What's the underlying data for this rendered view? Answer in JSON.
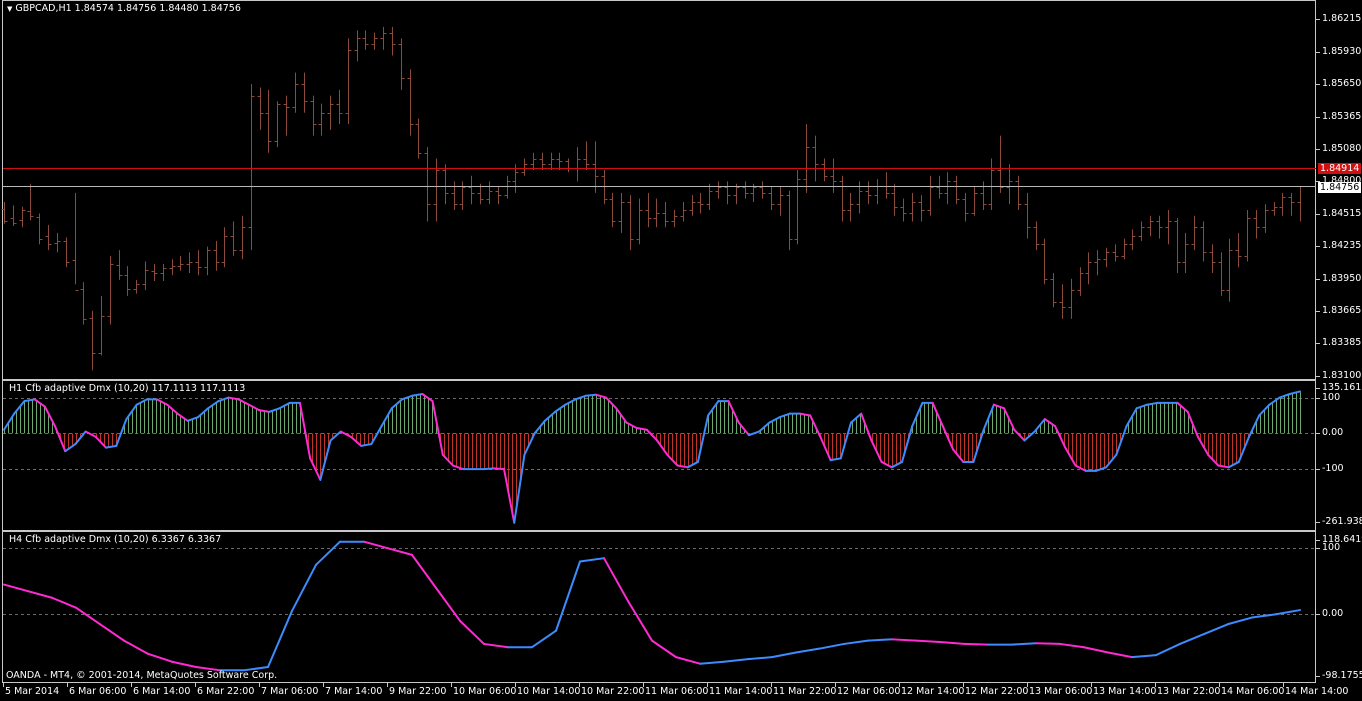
{
  "chart_title": "GBPCAD,H1  1.84574 1.84756 1.84480 1.84756",
  "copyright": "OANDA - MT4, © 2001-2014, MetaQuotes Software Corp.",
  "colors": {
    "candle": "#8b4a3a",
    "bid_line": "#b8b8b8",
    "level_line": "#d01010",
    "bull": "#3c8cff",
    "bear": "#ff2ad4",
    "hist_up": "#6ea86e",
    "hist_down": "#c0352a",
    "background": "#000000",
    "frame": "#c8c8c8"
  },
  "price_pane": {
    "price_labels": [
      "1.86215",
      "1.85930",
      "1.85650",
      "1.85365",
      "1.85080",
      "1.84800",
      "1.84515",
      "1.84235",
      "1.83950",
      "1.83665",
      "1.83385",
      "1.83100"
    ],
    "level_label": "1.84914",
    "current_label": "1.84756"
  },
  "h1_pane": {
    "title": "H1 Cfb adaptive Dmx (10,20) 117.1113 117.1113",
    "labels": [
      "135.1613",
      "100",
      "0.00",
      "-100",
      "-261.9386"
    ]
  },
  "h4_pane": {
    "title": "H4 Cfb adaptive Dmx (10,20) 6.3367 6.3367",
    "labels": [
      "118.6419",
      "100",
      "0.00",
      "-98.1755"
    ]
  },
  "time_labels": [
    "5 Mar 2014",
    "6 Mar 06:00",
    "6 Mar 14:00",
    "6 Mar 22:00",
    "7 Mar 06:00",
    "7 Mar 14:00",
    "9 Mar 22:00",
    "10 Mar 06:00",
    "10 Mar 14:00",
    "10 Mar 22:00",
    "11 Mar 06:00",
    "11 Mar 14:00",
    "11 Mar 22:00",
    "12 Mar 06:00",
    "12 Mar 14:00",
    "12 Mar 22:00",
    "13 Mar 06:00",
    "13 Mar 14:00",
    "13 Mar 22:00",
    "14 Mar 06:00",
    "14 Mar 14:00"
  ],
  "chart_data": [
    {
      "type": "bar",
      "title": "GBPCAD,H1",
      "ylim": [
        1.831,
        1.8635
      ],
      "hlines": [
        1.84914,
        1.84756
      ],
      "bars": [
        [
          1.8456,
          1.8443,
          1.8462,
          1.8445
        ],
        [
          1.8448,
          1.8441,
          1.8459,
          1.8444
        ],
        [
          1.8446,
          1.844,
          1.8458,
          1.8455
        ],
        [
          1.8454,
          1.8446,
          1.8478,
          1.845
        ],
        [
          1.8449,
          1.8425,
          1.8452,
          1.843
        ],
        [
          1.8432,
          1.842,
          1.8442,
          1.8425
        ],
        [
          1.8426,
          1.8418,
          1.8435,
          1.8428
        ],
        [
          1.8428,
          1.8405,
          1.8431,
          1.841
        ],
        [
          1.8411,
          1.839,
          1.847,
          1.8385
        ],
        [
          1.8386,
          1.8355,
          1.8392,
          1.836
        ],
        [
          1.8361,
          1.8315,
          1.8367,
          1.833
        ],
        [
          1.833,
          1.8328,
          1.838,
          1.8362
        ],
        [
          1.8362,
          1.8355,
          1.8415,
          1.8408
        ],
        [
          1.8407,
          1.8394,
          1.842,
          1.8398
        ],
        [
          1.8398,
          1.838,
          1.8406,
          1.8386
        ],
        [
          1.8386,
          1.8382,
          1.8394,
          1.839
        ],
        [
          1.839,
          1.8385,
          1.841,
          1.8403
        ],
        [
          1.8402,
          1.8393,
          1.8408,
          1.84
        ],
        [
          1.84,
          1.8393,
          1.8408,
          1.8404
        ],
        [
          1.8404,
          1.8398,
          1.8412,
          1.8406
        ],
        [
          1.8406,
          1.8402,
          1.8415,
          1.8408
        ],
        [
          1.8408,
          1.84,
          1.8418,
          1.841
        ],
        [
          1.841,
          1.8398,
          1.842,
          1.8405
        ],
        [
          1.8405,
          1.8398,
          1.8423,
          1.842
        ],
        [
          1.842,
          1.8402,
          1.8428,
          1.841
        ],
        [
          1.841,
          1.8405,
          1.844,
          1.8432
        ],
        [
          1.8432,
          1.8415,
          1.8445,
          1.842
        ],
        [
          1.842,
          1.8412,
          1.845,
          1.844
        ],
        [
          1.844,
          1.842,
          1.8565,
          1.8555
        ],
        [
          1.8555,
          1.8525,
          1.8562,
          1.854
        ],
        [
          1.854,
          1.8505,
          1.856,
          1.8515
        ],
        [
          1.8515,
          1.851,
          1.855,
          1.8548
        ],
        [
          1.8548,
          1.852,
          1.8555,
          1.8545
        ],
        [
          1.8545,
          1.854,
          1.8575,
          1.8565
        ],
        [
          1.8565,
          1.854,
          1.8575,
          1.855
        ],
        [
          1.855,
          1.852,
          1.8555,
          1.853
        ],
        [
          1.853,
          1.852,
          1.8548,
          1.854
        ],
        [
          1.854,
          1.8525,
          1.8555,
          1.8548
        ],
        [
          1.8548,
          1.853,
          1.856,
          1.854
        ],
        [
          1.854,
          1.853,
          1.8605,
          1.8595
        ],
        [
          1.8595,
          1.8585,
          1.8612,
          1.8605
        ],
        [
          1.8605,
          1.8595,
          1.8612,
          1.86
        ],
        [
          1.86,
          1.8595,
          1.861,
          1.8605
        ],
        [
          1.8605,
          1.8595,
          1.8615,
          1.861
        ],
        [
          1.861,
          1.859,
          1.8615,
          1.86
        ],
        [
          1.86,
          1.856,
          1.8605,
          1.857
        ],
        [
          1.857,
          1.852,
          1.8578,
          1.853
        ],
        [
          1.853,
          1.85,
          1.8535,
          1.8505
        ],
        [
          1.8505,
          1.8445,
          1.851,
          1.846
        ],
        [
          1.846,
          1.8445,
          1.85,
          1.849
        ],
        [
          1.849,
          1.846,
          1.8495,
          1.847
        ],
        [
          1.847,
          1.8455,
          1.848,
          1.846
        ],
        [
          1.846,
          1.8455,
          1.848,
          1.8475
        ],
        [
          1.8475,
          1.846,
          1.8485,
          1.847
        ],
        [
          1.847,
          1.846,
          1.8478,
          1.8465
        ],
        [
          1.8465,
          1.846,
          1.848,
          1.8472
        ],
        [
          1.8472,
          1.846,
          1.8476,
          1.8468
        ],
        [
          1.8468,
          1.8465,
          1.8485,
          1.848
        ],
        [
          1.848,
          1.847,
          1.8495,
          1.8488
        ],
        [
          1.8488,
          1.8485,
          1.85,
          1.8495
        ],
        [
          1.8495,
          1.849,
          1.8505,
          1.85
        ],
        [
          1.85,
          1.849,
          1.8505,
          1.8495
        ],
        [
          1.8495,
          1.849,
          1.8505,
          1.85
        ],
        [
          1.85,
          1.849,
          1.8505,
          1.8498
        ],
        [
          1.8498,
          1.8488,
          1.85,
          1.8492
        ],
        [
          1.8492,
          1.848,
          1.851,
          1.85
        ],
        [
          1.85,
          1.849,
          1.8515,
          1.8495
        ],
        [
          1.8495,
          1.847,
          1.8515,
          1.8485
        ],
        [
          1.8485,
          1.846,
          1.849,
          1.8465
        ],
        [
          1.8465,
          1.844,
          1.847,
          1.8445
        ],
        [
          1.8445,
          1.8435,
          1.847,
          1.8462
        ],
        [
          1.8462,
          1.842,
          1.8468,
          1.843
        ],
        [
          1.843,
          1.8425,
          1.8465,
          1.8455
        ],
        [
          1.8455,
          1.844,
          1.847,
          1.8448
        ],
        [
          1.8448,
          1.844,
          1.8465,
          1.8452
        ],
        [
          1.8452,
          1.844,
          1.8462,
          1.8445
        ],
        [
          1.8445,
          1.844,
          1.8455,
          1.845
        ],
        [
          1.845,
          1.8445,
          1.8462,
          1.8455
        ],
        [
          1.8455,
          1.845,
          1.8468,
          1.8462
        ],
        [
          1.8462,
          1.8452,
          1.847,
          1.846
        ],
        [
          1.846,
          1.8455,
          1.8478,
          1.8472
        ],
        [
          1.8472,
          1.8465,
          1.848,
          1.8475
        ],
        [
          1.8475,
          1.846,
          1.848,
          1.8468
        ],
        [
          1.8468,
          1.846,
          1.8478,
          1.8475
        ],
        [
          1.8475,
          1.8465,
          1.848,
          1.847
        ],
        [
          1.847,
          1.8462,
          1.8478,
          1.8475
        ],
        [
          1.8475,
          1.8465,
          1.848,
          1.847
        ],
        [
          1.847,
          1.8455,
          1.8475,
          1.846
        ],
        [
          1.846,
          1.845,
          1.8475,
          1.8468
        ],
        [
          1.8468,
          1.842,
          1.8472,
          1.843
        ],
        [
          1.843,
          1.8425,
          1.849,
          1.8482
        ],
        [
          1.8482,
          1.847,
          1.853,
          1.851
        ],
        [
          1.851,
          1.848,
          1.852,
          1.8495
        ],
        [
          1.8495,
          1.848,
          1.85,
          1.8485
        ],
        [
          1.8485,
          1.847,
          1.85,
          1.848
        ],
        [
          1.848,
          1.8445,
          1.8485,
          1.8455
        ],
        [
          1.8455,
          1.8445,
          1.847,
          1.846
        ],
        [
          1.846,
          1.8452,
          1.848,
          1.8472
        ],
        [
          1.8472,
          1.846,
          1.848,
          1.8468
        ],
        [
          1.8468,
          1.846,
          1.8482,
          1.8476
        ],
        [
          1.8476,
          1.8465,
          1.8488,
          1.847
        ],
        [
          1.847,
          1.845,
          1.8478,
          1.8458
        ],
        [
          1.8458,
          1.8445,
          1.8465,
          1.8452
        ],
        [
          1.8452,
          1.8445,
          1.847,
          1.8462
        ],
        [
          1.8462,
          1.8445,
          1.8468,
          1.8455
        ],
        [
          1.8455,
          1.845,
          1.8485,
          1.8475
        ],
        [
          1.8475,
          1.8465,
          1.8485,
          1.847
        ],
        [
          1.847,
          1.846,
          1.8488,
          1.848
        ],
        [
          1.848,
          1.846,
          1.8485,
          1.8465
        ],
        [
          1.8465,
          1.8445,
          1.847,
          1.8452
        ],
        [
          1.8452,
          1.845,
          1.8475,
          1.847
        ],
        [
          1.847,
          1.8455,
          1.848,
          1.846
        ],
        [
          1.846,
          1.8455,
          1.85,
          1.849
        ],
        [
          1.849,
          1.847,
          1.852,
          1.8475
        ],
        [
          1.8475,
          1.846,
          1.8495,
          1.848
        ],
        [
          1.848,
          1.8455,
          1.8485,
          1.846
        ],
        [
          1.846,
          1.843,
          1.847,
          1.844
        ],
        [
          1.844,
          1.842,
          1.8445,
          1.8425
        ],
        [
          1.8425,
          1.839,
          1.843,
          1.8395
        ],
        [
          1.8395,
          1.837,
          1.84,
          1.8375
        ],
        [
          1.8375,
          1.836,
          1.839,
          1.837
        ],
        [
          1.837,
          1.836,
          1.8395,
          1.8385
        ],
        [
          1.8385,
          1.838,
          1.8405,
          1.84
        ],
        [
          1.84,
          1.839,
          1.8418,
          1.841
        ],
        [
          1.841,
          1.8398,
          1.842,
          1.8412
        ],
        [
          1.8412,
          1.8405,
          1.8422,
          1.8418
        ],
        [
          1.8418,
          1.841,
          1.8425,
          1.8415
        ],
        [
          1.8415,
          1.8412,
          1.843,
          1.8425
        ],
        [
          1.8425,
          1.842,
          1.8438,
          1.8432
        ],
        [
          1.8432,
          1.8428,
          1.8445,
          1.844
        ],
        [
          1.844,
          1.8432,
          1.845,
          1.8445
        ],
        [
          1.8445,
          1.843,
          1.845,
          1.844
        ],
        [
          1.844,
          1.8425,
          1.8455,
          1.8445
        ],
        [
          1.8445,
          1.84,
          1.8448,
          1.841
        ],
        [
          1.841,
          1.84,
          1.8435,
          1.8425
        ],
        [
          1.8425,
          1.842,
          1.845,
          1.844
        ],
        [
          1.844,
          1.841,
          1.8445,
          1.8418
        ],
        [
          1.8418,
          1.84,
          1.8425,
          1.841
        ],
        [
          1.841,
          1.838,
          1.8418,
          1.8385
        ],
        [
          1.8385,
          1.8375,
          1.843,
          1.842
        ],
        [
          1.842,
          1.8405,
          1.8435,
          1.8415
        ],
        [
          1.8415,
          1.841,
          1.8455,
          1.8448
        ],
        [
          1.8448,
          1.843,
          1.8455,
          1.844
        ],
        [
          1.844,
          1.8435,
          1.846,
          1.8455
        ],
        [
          1.8455,
          1.845,
          1.8462,
          1.8458
        ],
        [
          1.8458,
          1.845,
          1.847,
          1.8466
        ],
        [
          1.8466,
          1.845,
          1.847,
          1.8462
        ],
        [
          1.8462,
          1.8445,
          1.8476,
          1.8476
        ]
      ]
    },
    {
      "type": "line",
      "title": "H1 Cfb adaptive Dmx (10,20)",
      "ylim": [
        -261.9386,
        135.1613
      ],
      "hlines": [
        100,
        0,
        -100
      ],
      "values": [
        10,
        55,
        90,
        95,
        75,
        20,
        -50,
        -30,
        5,
        -10,
        -40,
        -35,
        40,
        80,
        95,
        95,
        80,
        55,
        35,
        45,
        70,
        90,
        100,
        95,
        80,
        65,
        60,
        70,
        85,
        85,
        -70,
        -130,
        -20,
        5,
        -10,
        -35,
        -30,
        20,
        70,
        95,
        105,
        110,
        90,
        -60,
        -90,
        -100,
        -100,
        -100,
        -98,
        -100,
        -250,
        -60,
        0,
        35,
        60,
        80,
        95,
        105,
        108,
        100,
        70,
        30,
        15,
        10,
        -20,
        -60,
        -90,
        -95,
        -80,
        50,
        90,
        90,
        30,
        -5,
        5,
        30,
        45,
        55,
        55,
        50,
        -10,
        -75,
        -70,
        30,
        55,
        -20,
        -80,
        -95,
        -80,
        20,
        85,
        85,
        20,
        -45,
        -80,
        -80,
        10,
        80,
        70,
        10,
        -20,
        5,
        40,
        20,
        -40,
        -90,
        -105,
        -105,
        -95,
        -60,
        20,
        70,
        80,
        85,
        85,
        85,
        60,
        -10,
        -60,
        -90,
        -95,
        -80,
        -10,
        50,
        80,
        100,
        110,
        117.1113
      ]
    },
    {
      "type": "line",
      "title": "H4 Cfb adaptive Dmx (10,20)",
      "ylim": [
        -98.1755,
        118.6419
      ],
      "hlines": [
        100,
        0
      ],
      "values": [
        45,
        35,
        25,
        10,
        -15,
        -40,
        -60,
        -72,
        -80,
        -85,
        -85,
        -80,
        5,
        75,
        110,
        110,
        100,
        90,
        40,
        -10,
        -45,
        -50,
        -50,
        -25,
        80,
        85,
        20,
        -40,
        -65,
        -75,
        -72,
        -68,
        -65,
        -58,
        -52,
        -45,
        -40,
        -38,
        -40,
        -42,
        -45,
        -46,
        -46,
        -44,
        -45,
        -50,
        -58,
        -65,
        -62,
        -45,
        -30,
        -15,
        -5,
        0,
        6.3367
      ]
    }
  ]
}
